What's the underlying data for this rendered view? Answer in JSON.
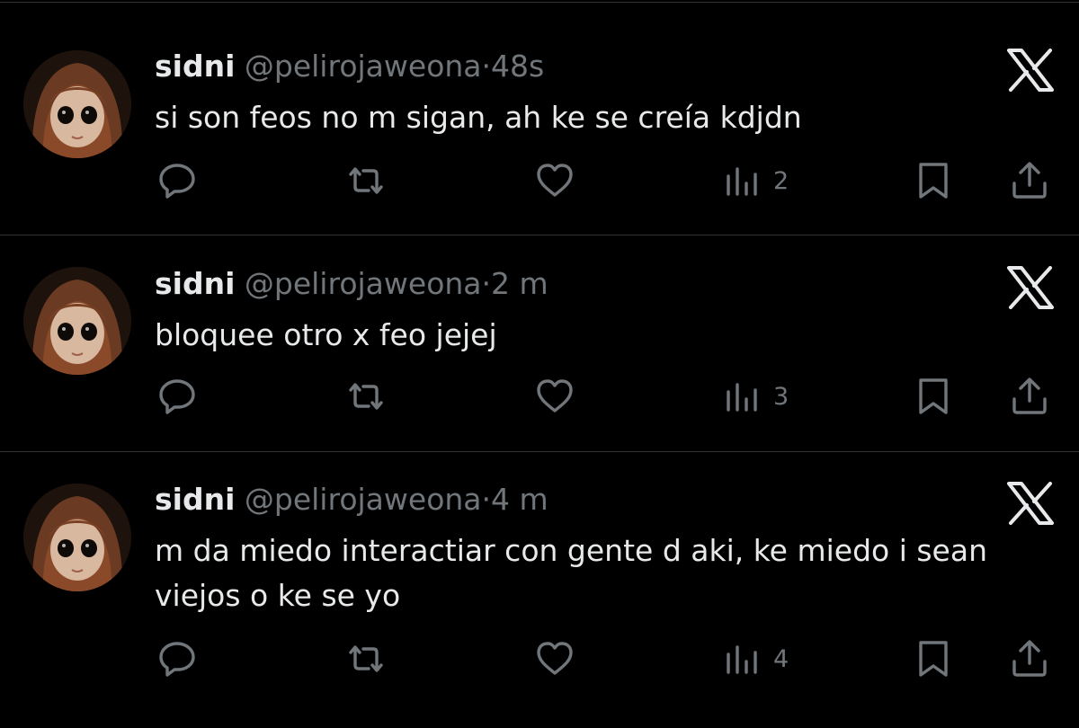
{
  "colors": {
    "background": "#000000",
    "primary_text": "#e7e9ea",
    "secondary_text": "#71767b",
    "divider": "#2f3336"
  },
  "icons": {
    "reply": "speech-bubble-icon",
    "repost": "repost-arrows-icon",
    "like": "heart-icon",
    "views": "bar-chart-icon",
    "bookmark": "bookmark-icon",
    "share": "share-upload-icon",
    "platform": "x-logo-icon"
  },
  "tweets": [
    {
      "name": "sidni",
      "handle": "@pelirojaweona",
      "separator": "·",
      "time": "48s",
      "text": "si son feos no m sigan, ah ke se creía kdjdn",
      "views": "2"
    },
    {
      "name": "sidni",
      "handle": "@pelirojaweona",
      "separator": "·",
      "time": "2 m",
      "text": "bloquee otro x feo jejej",
      "views": "3"
    },
    {
      "name": "sidni",
      "handle": "@pelirojaweona",
      "separator": "·",
      "time": "4 m",
      "text": "m da miedo interactiar con gente d aki, ke miedo i sean viejos o ke se yo",
      "views": "4"
    }
  ]
}
